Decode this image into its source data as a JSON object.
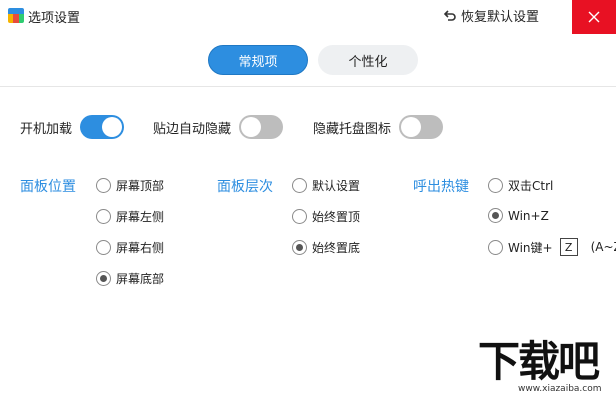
{
  "window": {
    "title": "选项设置",
    "restore_label": "恢复默认设置",
    "accent_color": "#2d8ee0",
    "close_color": "#e81123"
  },
  "tabs": [
    {
      "label": "常规项",
      "active": true
    },
    {
      "label": "个性化",
      "active": false
    }
  ],
  "toggles": [
    {
      "label": "开机加载",
      "on": true
    },
    {
      "label": "贴边自动隐藏",
      "on": false
    },
    {
      "label": "隐藏托盘图标",
      "on": false
    }
  ],
  "panel_position": {
    "title": "面板位置",
    "options": [
      {
        "label": "屏幕顶部",
        "checked": false
      },
      {
        "label": "屏幕左侧",
        "checked": false
      },
      {
        "label": "屏幕右侧",
        "checked": false
      },
      {
        "label": "屏幕底部",
        "checked": true
      }
    ]
  },
  "panel_layer": {
    "title": "面板层次",
    "options": [
      {
        "label": "默认设置",
        "checked": false
      },
      {
        "label": "始终置顶",
        "checked": false
      },
      {
        "label": "始终置底",
        "checked": true
      }
    ]
  },
  "hotkey": {
    "title": "呼出热键",
    "options": [
      {
        "label": "双击Ctrl",
        "checked": false
      },
      {
        "label": "Win+Z",
        "checked": true
      },
      {
        "label": "Win键+",
        "checked": false
      }
    ],
    "key_value": "Z",
    "key_hint": "(A~Z)"
  },
  "watermark": {
    "text": "下载吧",
    "url": "www.xiazaiba.com"
  }
}
